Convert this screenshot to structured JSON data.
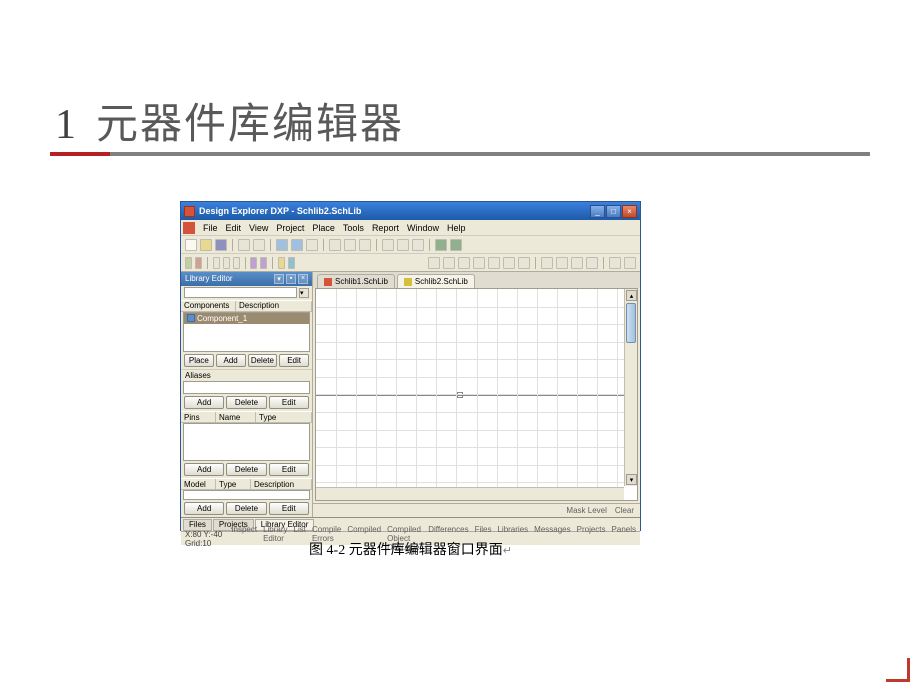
{
  "slide": {
    "number": "1",
    "title": "元器件库编辑器"
  },
  "window": {
    "title": "Design Explorer DXP - Schlib2.SchLib",
    "menus": [
      "File",
      "Edit",
      "View",
      "Project",
      "Place",
      "Tools",
      "Report",
      "Window",
      "Help"
    ]
  },
  "panel": {
    "title": "Library Editor",
    "components_header": {
      "col1": "Components",
      "col2": "Description"
    },
    "component_row": "Component_1",
    "buttons": {
      "place": "Place",
      "add": "Add",
      "delete": "Delete",
      "edit": "Edit"
    },
    "aliases_label": "Aliases",
    "pins_header": {
      "col1": "Pins",
      "col2": "Name",
      "col3": "Type"
    },
    "model_header": {
      "col1": "Model",
      "col2": "Type",
      "col3": "Description"
    }
  },
  "tabs": {
    "canvas1": "Schlib1.SchLib",
    "canvas2": "Schlib2.SchLib",
    "bottom": [
      "Files",
      "Projects",
      "Library Editor"
    ],
    "bottom_right": [
      "Mask Level",
      "Clear"
    ]
  },
  "statusbar": {
    "left": "X:80 Y:-40   Grid:10",
    "right": [
      "Inspect",
      "Library Editor",
      "List",
      "Compile Errors",
      "Compiled",
      "Compiled Object Debugger",
      "Differences",
      "Files",
      "Libraries",
      "Messages",
      "Projects",
      "Panels"
    ]
  },
  "caption": "图 4-2  元器件库编辑器窗口界面"
}
